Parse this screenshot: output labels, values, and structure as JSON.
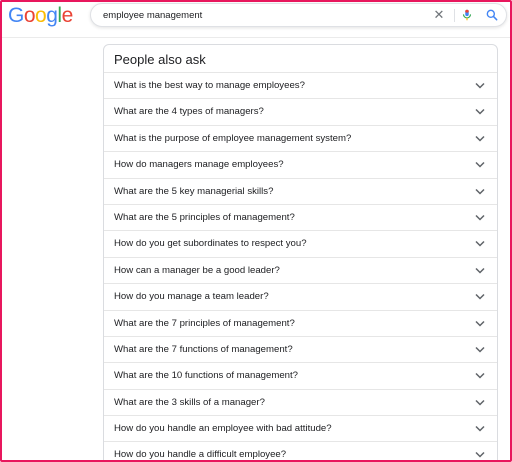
{
  "header": {
    "logo_letters": [
      "G",
      "o",
      "o",
      "g",
      "l",
      "e"
    ],
    "logo_colors": [
      "#4285f4",
      "#ea4335",
      "#fbbc05",
      "#4285f4",
      "#34a853",
      "#ea4335"
    ],
    "search": {
      "value": "employee management",
      "placeholder": ""
    },
    "icons": [
      "close-icon",
      "mic-icon",
      "search-icon"
    ]
  },
  "paa": {
    "heading": "People also ask",
    "questions": [
      "What is the best way to manage employees?",
      "What are the 4 types of managers?",
      "What is the purpose of employee management system?",
      "How do managers manage employees?",
      "What are the 5 key managerial skills?",
      "What are the 5 principles of management?",
      "How do you get subordinates to respect you?",
      "How can a manager be a good leader?",
      "How do you manage a team leader?",
      "What are the 7 principles of management?",
      "What are the 7 functions of management?",
      "What are the 10 functions of management?",
      "What are the 3 skills of a manager?",
      "How do you handle an employee with bad attitude?",
      "How do you handle a difficult employee?"
    ]
  },
  "colors": {
    "frame_border": "#e8175d",
    "accent_blue": "#4285f4",
    "text": "#202124"
  }
}
